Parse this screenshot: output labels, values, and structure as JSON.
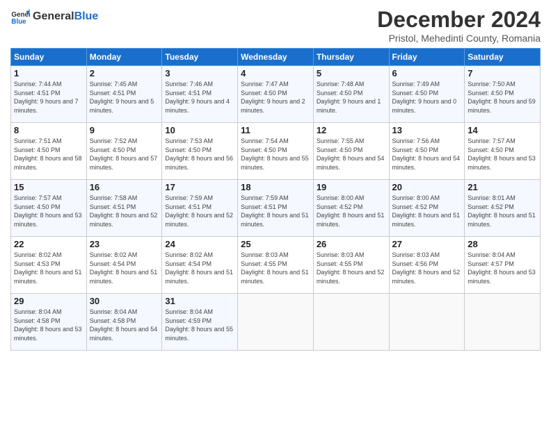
{
  "header": {
    "logo_general": "General",
    "logo_blue": "Blue",
    "month_title": "December 2024",
    "location": "Pristol, Mehedinti County, Romania"
  },
  "days_of_week": [
    "Sunday",
    "Monday",
    "Tuesday",
    "Wednesday",
    "Thursday",
    "Friday",
    "Saturday"
  ],
  "weeks": [
    [
      {
        "day": "1",
        "sunrise": "Sunrise: 7:44 AM",
        "sunset": "Sunset: 4:51 PM",
        "daylight": "Daylight: 9 hours and 7 minutes."
      },
      {
        "day": "2",
        "sunrise": "Sunrise: 7:45 AM",
        "sunset": "Sunset: 4:51 PM",
        "daylight": "Daylight: 9 hours and 5 minutes."
      },
      {
        "day": "3",
        "sunrise": "Sunrise: 7:46 AM",
        "sunset": "Sunset: 4:51 PM",
        "daylight": "Daylight: 9 hours and 4 minutes."
      },
      {
        "day": "4",
        "sunrise": "Sunrise: 7:47 AM",
        "sunset": "Sunset: 4:50 PM",
        "daylight": "Daylight: 9 hours and 2 minutes."
      },
      {
        "day": "5",
        "sunrise": "Sunrise: 7:48 AM",
        "sunset": "Sunset: 4:50 PM",
        "daylight": "Daylight: 9 hours and 1 minute."
      },
      {
        "day": "6",
        "sunrise": "Sunrise: 7:49 AM",
        "sunset": "Sunset: 4:50 PM",
        "daylight": "Daylight: 9 hours and 0 minutes."
      },
      {
        "day": "7",
        "sunrise": "Sunrise: 7:50 AM",
        "sunset": "Sunset: 4:50 PM",
        "daylight": "Daylight: 8 hours and 59 minutes."
      }
    ],
    [
      {
        "day": "8",
        "sunrise": "Sunrise: 7:51 AM",
        "sunset": "Sunset: 4:50 PM",
        "daylight": "Daylight: 8 hours and 58 minutes."
      },
      {
        "day": "9",
        "sunrise": "Sunrise: 7:52 AM",
        "sunset": "Sunset: 4:50 PM",
        "daylight": "Daylight: 8 hours and 57 minutes."
      },
      {
        "day": "10",
        "sunrise": "Sunrise: 7:53 AM",
        "sunset": "Sunset: 4:50 PM",
        "daylight": "Daylight: 8 hours and 56 minutes."
      },
      {
        "day": "11",
        "sunrise": "Sunrise: 7:54 AM",
        "sunset": "Sunset: 4:50 PM",
        "daylight": "Daylight: 8 hours and 55 minutes."
      },
      {
        "day": "12",
        "sunrise": "Sunrise: 7:55 AM",
        "sunset": "Sunset: 4:50 PM",
        "daylight": "Daylight: 8 hours and 54 minutes."
      },
      {
        "day": "13",
        "sunrise": "Sunrise: 7:56 AM",
        "sunset": "Sunset: 4:50 PM",
        "daylight": "Daylight: 8 hours and 54 minutes."
      },
      {
        "day": "14",
        "sunrise": "Sunrise: 7:57 AM",
        "sunset": "Sunset: 4:50 PM",
        "daylight": "Daylight: 8 hours and 53 minutes."
      }
    ],
    [
      {
        "day": "15",
        "sunrise": "Sunrise: 7:57 AM",
        "sunset": "Sunset: 4:50 PM",
        "daylight": "Daylight: 8 hours and 53 minutes."
      },
      {
        "day": "16",
        "sunrise": "Sunrise: 7:58 AM",
        "sunset": "Sunset: 4:51 PM",
        "daylight": "Daylight: 8 hours and 52 minutes."
      },
      {
        "day": "17",
        "sunrise": "Sunrise: 7:59 AM",
        "sunset": "Sunset: 4:51 PM",
        "daylight": "Daylight: 8 hours and 52 minutes."
      },
      {
        "day": "18",
        "sunrise": "Sunrise: 7:59 AM",
        "sunset": "Sunset: 4:51 PM",
        "daylight": "Daylight: 8 hours and 51 minutes."
      },
      {
        "day": "19",
        "sunrise": "Sunrise: 8:00 AM",
        "sunset": "Sunset: 4:52 PM",
        "daylight": "Daylight: 8 hours and 51 minutes."
      },
      {
        "day": "20",
        "sunrise": "Sunrise: 8:00 AM",
        "sunset": "Sunset: 4:52 PM",
        "daylight": "Daylight: 8 hours and 51 minutes."
      },
      {
        "day": "21",
        "sunrise": "Sunrise: 8:01 AM",
        "sunset": "Sunset: 4:52 PM",
        "daylight": "Daylight: 8 hours and 51 minutes."
      }
    ],
    [
      {
        "day": "22",
        "sunrise": "Sunrise: 8:02 AM",
        "sunset": "Sunset: 4:53 PM",
        "daylight": "Daylight: 8 hours and 51 minutes."
      },
      {
        "day": "23",
        "sunrise": "Sunrise: 8:02 AM",
        "sunset": "Sunset: 4:54 PM",
        "daylight": "Daylight: 8 hours and 51 minutes."
      },
      {
        "day": "24",
        "sunrise": "Sunrise: 8:02 AM",
        "sunset": "Sunset: 4:54 PM",
        "daylight": "Daylight: 8 hours and 51 minutes."
      },
      {
        "day": "25",
        "sunrise": "Sunrise: 8:03 AM",
        "sunset": "Sunset: 4:55 PM",
        "daylight": "Daylight: 8 hours and 51 minutes."
      },
      {
        "day": "26",
        "sunrise": "Sunrise: 8:03 AM",
        "sunset": "Sunset: 4:55 PM",
        "daylight": "Daylight: 8 hours and 52 minutes."
      },
      {
        "day": "27",
        "sunrise": "Sunrise: 8:03 AM",
        "sunset": "Sunset: 4:56 PM",
        "daylight": "Daylight: 8 hours and 52 minutes."
      },
      {
        "day": "28",
        "sunrise": "Sunrise: 8:04 AM",
        "sunset": "Sunset: 4:57 PM",
        "daylight": "Daylight: 8 hours and 53 minutes."
      }
    ],
    [
      {
        "day": "29",
        "sunrise": "Sunrise: 8:04 AM",
        "sunset": "Sunset: 4:58 PM",
        "daylight": "Daylight: 8 hours and 53 minutes."
      },
      {
        "day": "30",
        "sunrise": "Sunrise: 8:04 AM",
        "sunset": "Sunset: 4:58 PM",
        "daylight": "Daylight: 8 hours and 54 minutes."
      },
      {
        "day": "31",
        "sunrise": "Sunrise: 8:04 AM",
        "sunset": "Sunset: 4:59 PM",
        "daylight": "Daylight: 8 hours and 55 minutes."
      },
      null,
      null,
      null,
      null
    ]
  ]
}
